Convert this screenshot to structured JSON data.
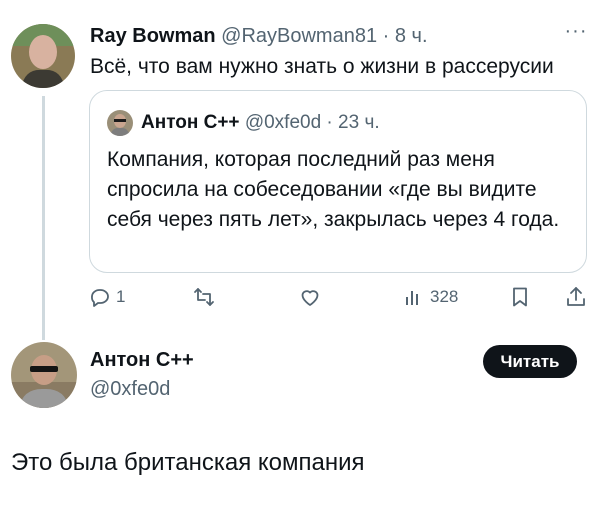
{
  "tweet": {
    "author_name": "Ray Bowman",
    "author_handle": "@RayBowman81",
    "separator": " · ",
    "time": "8 ч.",
    "text": "Всё, что вам нужно знать о жизни в рассерусии",
    "more_icon": "more-icon"
  },
  "quoted": {
    "author_name": "Антон C++",
    "author_handle": "@0xfe0d",
    "separator": " · ",
    "time": "23 ч.",
    "text": "Компания, которая последний раз меня спросила на собеседовании «где вы видите себя через пять лет», закрылась через 4 года."
  },
  "actions": {
    "reply": {
      "icon": "reply-icon",
      "count": "1"
    },
    "retweet": {
      "icon": "retweet-icon"
    },
    "like": {
      "icon": "like-icon"
    },
    "views": {
      "icon": "views-icon",
      "count": "328"
    },
    "bookmark": {
      "icon": "bookmark-icon"
    },
    "share": {
      "icon": "share-icon"
    }
  },
  "reply_tweet": {
    "author_name": "Антон C++",
    "author_handle": "@0xfe0d",
    "follow_label": "Читать",
    "text": "Это была британская компания"
  },
  "colors": {
    "text": "#0f1419",
    "muted": "#536471",
    "border": "#cfd9de",
    "button": "#0f1419"
  }
}
